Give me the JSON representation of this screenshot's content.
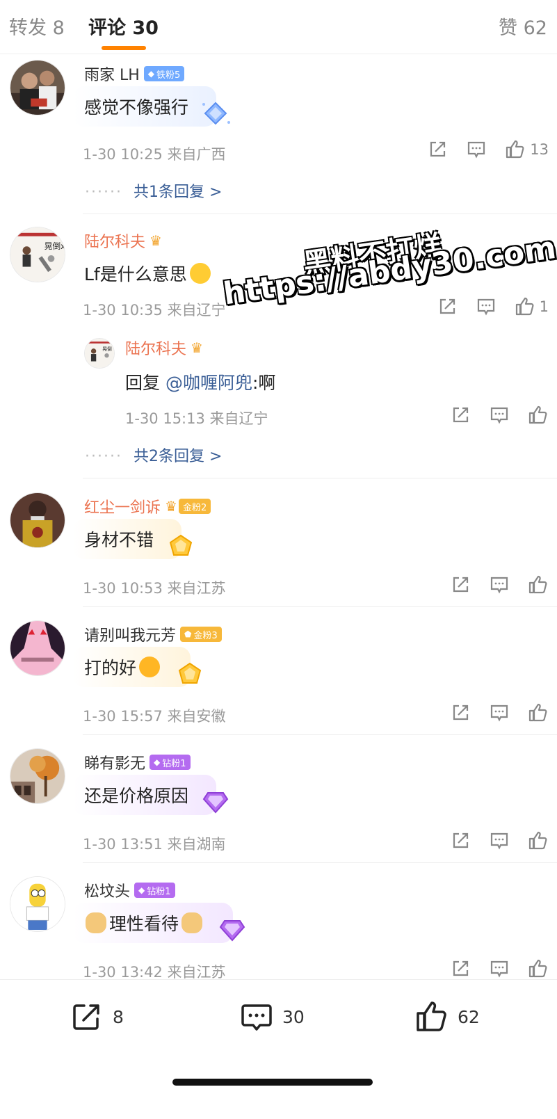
{
  "tabs": {
    "repost": "转发 8",
    "comments": "评论 30",
    "likes": "赞 62",
    "accent_color": "#ff8200"
  },
  "comments": [
    {
      "username": "雨家 LH",
      "badge": "铁粉5",
      "text": "感觉不像强行",
      "meta": "1-30 10:25  来自广西",
      "like_count": "13",
      "more_replies": "共1条回复 >"
    },
    {
      "username": "陆尔科夫",
      "text": "Lf是什么意思",
      "meta": "1-30 10:35  来自辽宁",
      "like_count": "1",
      "reply": {
        "username": "陆尔科夫",
        "prefix": "回复 ",
        "mention": "@咖喱阿兜",
        "text": ":啊",
        "meta": "1-30 15:13  来自辽宁"
      },
      "more_replies": "共2条回复 >"
    },
    {
      "username": "红尘一剑诉",
      "badge": "金粉2",
      "text": "身材不错",
      "meta": "1-30 10:53  来自江苏"
    },
    {
      "username": "请别叫我元芳",
      "badge": "金粉3",
      "text": "打的好",
      "meta": "1-30 15:57  来自安徽"
    },
    {
      "username": "睇有影无",
      "badge": "钻粉1",
      "text": "还是价格原因",
      "meta": "1-30 13:51  来自湖南"
    },
    {
      "username": "松坟头",
      "badge": "钻粉1",
      "text": "理性看待",
      "meta": "1-30 13:42  来自江苏"
    }
  ],
  "watermark": {
    "line1": "黑料不打烊",
    "line2": "https://abdy30.com"
  },
  "bottom_bar": {
    "repost_count": "8",
    "comment_count": "30",
    "like_count": "62"
  },
  "icons": [
    "repost-icon",
    "comment-icon",
    "like-icon",
    "crown-icon",
    "gem-icon"
  ]
}
